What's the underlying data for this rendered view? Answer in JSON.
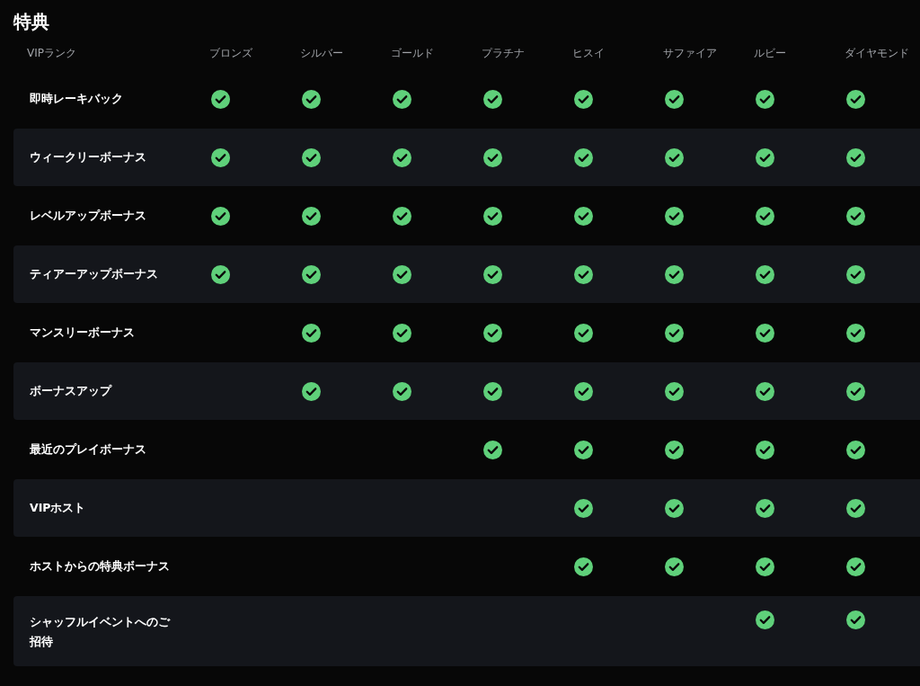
{
  "title": "特典",
  "table": {
    "columns": [
      "VIPランク",
      "ブロンズ",
      "シルバー",
      "ゴールド",
      "プラチナ",
      "ヒスイ",
      "サファイア",
      "ルビー",
      "ダイヤモンド"
    ],
    "rows": [
      {
        "label": "即時レーキバック",
        "cells": [
          {
            "checked": true
          },
          {
            "checked": true
          },
          {
            "checked": true
          },
          {
            "checked": true
          },
          {
            "checked": true
          },
          {
            "checked": true
          },
          {
            "checked": true
          },
          {
            "checked": true
          }
        ]
      },
      {
        "label": "ウィークリーボーナス",
        "cells": [
          {
            "checked": true
          },
          {
            "checked": true
          },
          {
            "checked": true
          },
          {
            "checked": true
          },
          {
            "checked": true
          },
          {
            "checked": true
          },
          {
            "checked": true
          },
          {
            "checked": true
          }
        ]
      },
      {
        "label": "レベルアップボーナス",
        "cells": [
          {
            "checked": true
          },
          {
            "checked": true
          },
          {
            "checked": true
          },
          {
            "checked": true
          },
          {
            "checked": true
          },
          {
            "checked": true
          },
          {
            "checked": true
          },
          {
            "checked": true
          }
        ]
      },
      {
        "label": "ティアーアップボーナス",
        "cells": [
          {
            "checked": true
          },
          {
            "checked": true
          },
          {
            "checked": true
          },
          {
            "checked": true
          },
          {
            "checked": true
          },
          {
            "checked": true
          },
          {
            "checked": true
          },
          {
            "checked": true
          }
        ]
      },
      {
        "label": "マンスリーボーナス",
        "cells": [
          {
            "checked": false
          },
          {
            "checked": true
          },
          {
            "checked": true
          },
          {
            "checked": true
          },
          {
            "checked": true
          },
          {
            "checked": true
          },
          {
            "checked": true
          },
          {
            "checked": true
          }
        ]
      },
      {
        "label": "ボーナスアップ",
        "cells": [
          {
            "checked": false
          },
          {
            "checked": true
          },
          {
            "checked": true
          },
          {
            "checked": true
          },
          {
            "checked": true
          },
          {
            "checked": true
          },
          {
            "checked": true
          },
          {
            "checked": true
          }
        ]
      },
      {
        "label": "最近のプレイボーナス",
        "cells": [
          {
            "checked": false
          },
          {
            "checked": false
          },
          {
            "checked": false
          },
          {
            "checked": true
          },
          {
            "checked": true
          },
          {
            "checked": true
          },
          {
            "checked": true
          },
          {
            "checked": true
          }
        ]
      },
      {
        "label": "VIPホスト",
        "cells": [
          {
            "checked": false
          },
          {
            "checked": false
          },
          {
            "checked": false
          },
          {
            "checked": false
          },
          {
            "checked": true
          },
          {
            "checked": true
          },
          {
            "checked": true
          },
          {
            "checked": true
          }
        ]
      },
      {
        "label": "ホストからの特典ボーナス",
        "cells": [
          {
            "checked": false
          },
          {
            "checked": false
          },
          {
            "checked": false
          },
          {
            "checked": false
          },
          {
            "checked": true
          },
          {
            "checked": true
          },
          {
            "checked": true
          },
          {
            "checked": true
          }
        ]
      },
      {
        "label": "シャッフルイベントへのご招待",
        "cells": [
          {
            "checked": false
          },
          {
            "checked": false
          },
          {
            "checked": false
          },
          {
            "checked": false
          },
          {
            "checked": false
          },
          {
            "checked": false
          },
          {
            "checked": true
          },
          {
            "checked": true
          }
        ]
      }
    ]
  }
}
